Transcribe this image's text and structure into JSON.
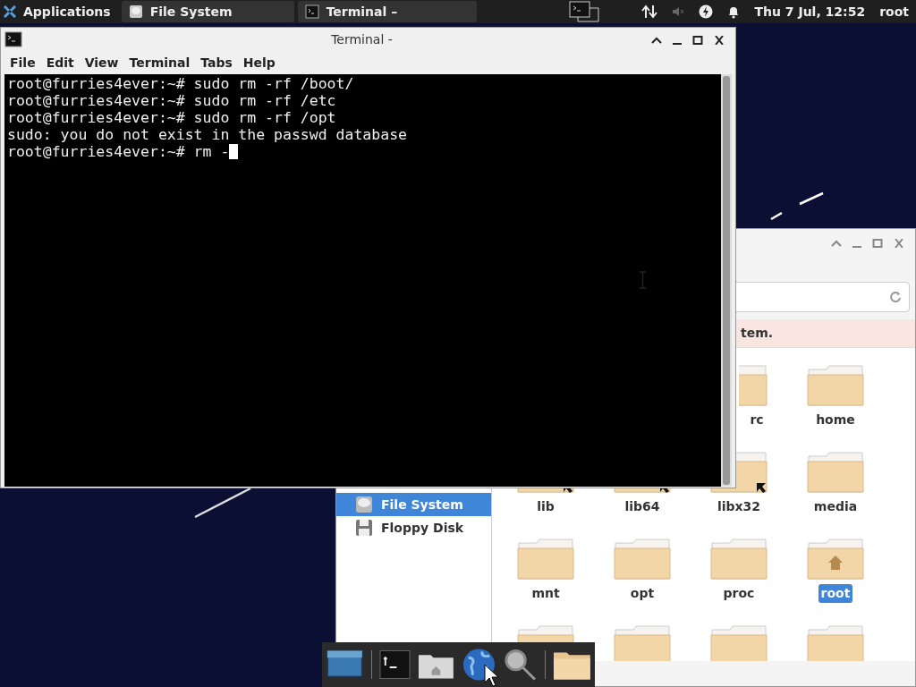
{
  "panel": {
    "apps_label": "Applications",
    "tasks": [
      {
        "label": "File System",
        "kind": "files"
      },
      {
        "label": "Terminal –",
        "kind": "terminal"
      }
    ],
    "clock": "Thu 7 Jul, 12:52",
    "user": "root"
  },
  "terminal": {
    "title": "Terminal -",
    "menu": [
      "File",
      "Edit",
      "View",
      "Terminal",
      "Tabs",
      "Help"
    ],
    "lines": [
      "root@furries4ever:~# sudo rm -rf /boot/",
      "root@furries4ever:~# sudo rm -rf /etc",
      "root@furries4ever:~# sudo rm -rf /opt",
      "sudo: you do not exist in the passwd database",
      "root@furries4ever:~# rm -"
    ]
  },
  "file_manager": {
    "info_text": "tem.",
    "sidebar": [
      {
        "label": "File System",
        "kind": "drive",
        "selected": true
      },
      {
        "label": "Floppy Disk",
        "kind": "floppy",
        "selected": false
      }
    ],
    "rows": [
      [
        "",
        "",
        {
          "label": "rc",
          "kind": "folder",
          "selected": false
        },
        {
          "label": "home",
          "kind": "folder",
          "selected": false
        }
      ],
      [
        {
          "label": "lib",
          "kind": "link",
          "selected": false
        },
        {
          "label": "lib64",
          "kind": "link",
          "selected": false
        },
        {
          "label": "libx32",
          "kind": "link",
          "selected": false
        },
        {
          "label": "media",
          "kind": "folder",
          "selected": false
        }
      ],
      [
        {
          "label": "mnt",
          "kind": "folder",
          "selected": false
        },
        {
          "label": "opt",
          "kind": "folder",
          "selected": false
        },
        {
          "label": "proc",
          "kind": "folder",
          "selected": false
        },
        {
          "label": "root",
          "kind": "home",
          "selected": true
        }
      ],
      [
        {
          "kind": "folder"
        },
        {
          "kind": "folder"
        },
        {
          "kind": "folder"
        },
        {
          "kind": "folder"
        }
      ]
    ]
  }
}
